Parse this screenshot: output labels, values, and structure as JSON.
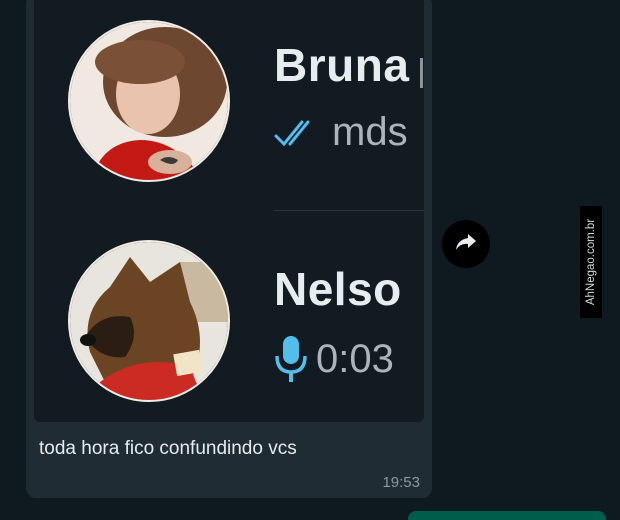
{
  "shared_preview": {
    "chats": [
      {
        "name": "Bruna",
        "last_message": "mds",
        "status_icon": "double-check-icon",
        "color": "#53bdeb"
      },
      {
        "name": "Nelso",
        "last_message": "0:03",
        "status_icon": "microphone-icon",
        "color": "#53bdeb"
      }
    ]
  },
  "message": {
    "text": "toda hora fico confundindo vcs",
    "time": "19:53"
  },
  "forward_icon": "forward-arrow-icon",
  "watermark": {
    "text": "AhNegao.com.br"
  },
  "colors": {
    "background": "#0f1a20",
    "bubble": "#1f2c33",
    "accent_blue": "#53bdeb",
    "outgoing_bubble": "#005c4b"
  }
}
